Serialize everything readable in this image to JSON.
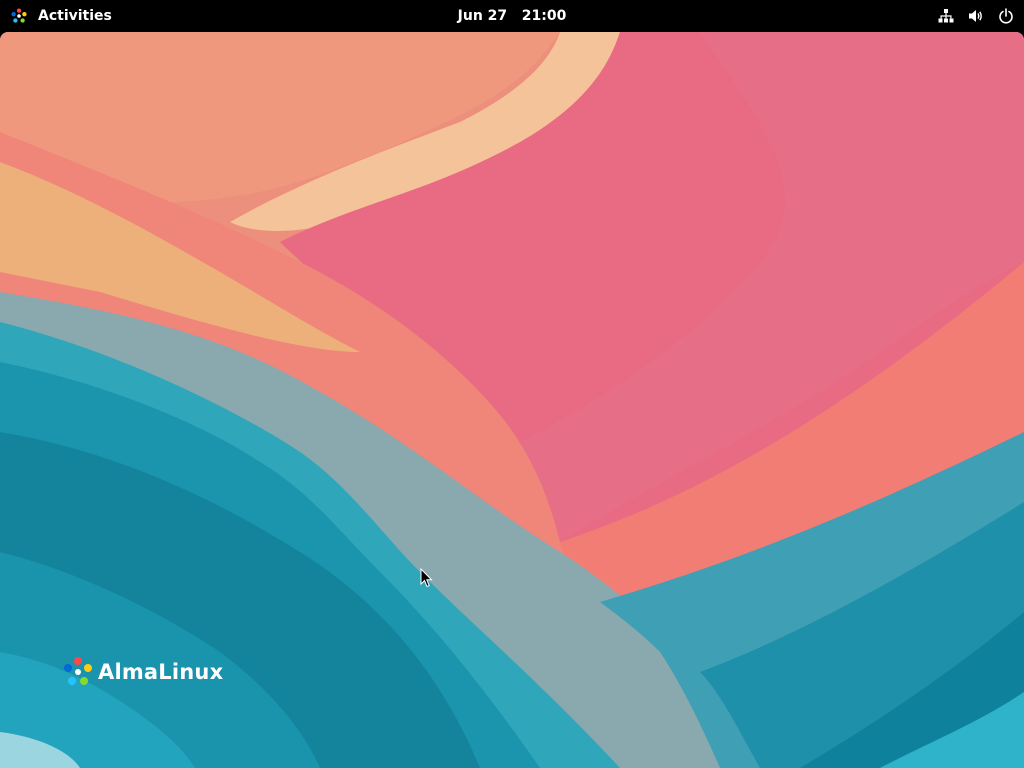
{
  "topbar": {
    "activities_label": "Activities",
    "clock_date": "Jun 27",
    "clock_time": "21:00",
    "tray_icons": [
      "network-wired-icon",
      "volume-icon",
      "power-icon"
    ]
  },
  "desktop": {
    "brand_text": "AlmaLinux",
    "wallpaper_colors": {
      "peach": "#F2A97E",
      "light_peach": "#F4C198",
      "salmon": "#EE8777",
      "pink": "#E66B82",
      "coral": "#F27C76",
      "teal": "#1E9DB2",
      "deep_teal": "#10879E",
      "gray_blue": "#8BA6AB"
    }
  }
}
